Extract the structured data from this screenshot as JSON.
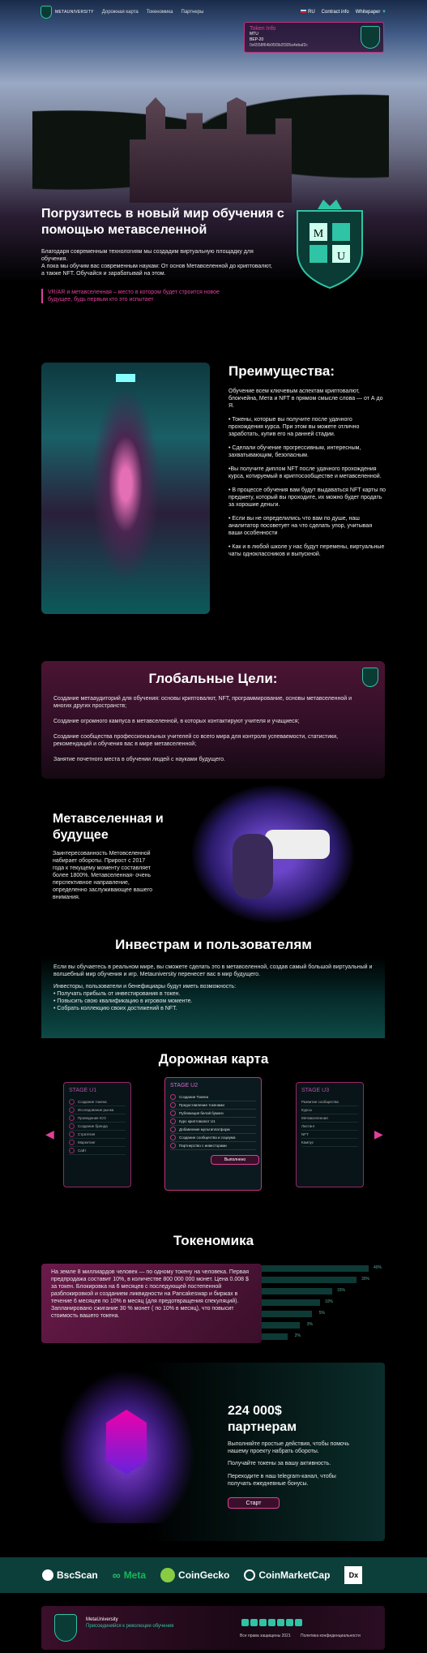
{
  "nav": {
    "logo": "METAUNIVERSITY",
    "links": [
      "Дорожная карта",
      "Токеномика",
      "Партнеры"
    ],
    "lang": "RU",
    "contract": "Contract info",
    "whitepaper": "Whitepaper"
  },
  "token_info": {
    "title": "Token Info",
    "name": "MTU",
    "line2": "BEP-20",
    "address": "0x6558f64b95f3b2f305a4ebaf2c"
  },
  "hero": {
    "title": "Погрузитесь в новый мир обучения с помощью метавселенной",
    "text1": "Благодаря современным технологиям мы создадим виртуальную площадку для обучения.",
    "text2": "А пока мы обучим вас современным наукам: От основ Метавселенной до криптовалют, а также NFT. Обучайся и зарабатывай на этом.",
    "quote": "VR/AR и метавселенная – место в котором будет строится новое будущее, будь первым кто это испытает"
  },
  "benefits": {
    "title": "Преимущества:",
    "items": [
      "Обучение всем ключевым аспектам криптовалют, блокчейна, Мета и NFT в прямом смысле слова — от А до Я.",
      "• Токены, которые вы получите после удачного прохождения курса. При этом вы можете отлично заработать, купив его на ранней стадии.",
      "• Сделали обучение прогрессивным, интересным, захватывающим, безопасным.",
      "•Вы получите диплом NFT после удачного прохождения курса, котируемый в криптосообществе и метавселенной.",
      "• В процессе обучения вам будут выдаваться NFT карты по предмету, который вы проходите, их можно будет продать за хорошие деньги.",
      "• Если вы не определились что вам по душе, наш аналитатор посоветует на что сделать упор, учитывая ваши особенности",
      "• Как и в любой школе у нас будут перемены, виртуальные чаты одноклассников и выпускной."
    ]
  },
  "goals": {
    "title": "Глобальные Цели:",
    "items": [
      "Создание метааудиторий для обучения: основы криптовалют, NFT, программирование, основы метавселенной и многих других пространств;",
      "Создание огромного кампуса в метавселенной, в которых контактируют учителя и учащиеся;",
      "Создание сообщества профессиональных учителей со всего мира для контроля успеваемости, статистики, рекомендаций и обучения вас в мире метавселенной;",
      "Занятие почетного места в обучении людей с науками будущего."
    ]
  },
  "meta": {
    "title": "Метавселенная и будущее",
    "text": "Заинтересованность Метовселенной набирает обороты. Прирост с 2017 года к текущему моменту составляет более 1800%. Метавселенная- очень перспективное направление, определенно заслуживающее вашего внимания."
  },
  "invest": {
    "title": "Инвестрам и пользователям",
    "text": "Если вы обучаетесь в реальном мире, вы сможете сделать это в метавселенной, создав самый большой виртуальный и волшебный мир обучения и игр. Metauniversity перенесет вас в мир будущего.",
    "sub": "Инвесторы, пользователи и бенефициары будут иметь возможность:",
    "items": [
      "• Получать прибыль от инвестирования в токен.",
      "• Повысить свою квалификацию в игровом моменте.",
      "• Собрать коллекцию своих достижений в NFT."
    ]
  },
  "roadmap": {
    "title": "Дорожная карта",
    "stages": [
      {
        "title": "STAGE U1",
        "rows": [
          "Создание токена",
          "Исследование рынка",
          "Проведение ICO",
          "Создание бренда",
          "Стратегия",
          "Маркетинг",
          "Сайт"
        ]
      },
      {
        "title": "STAGE U2",
        "rows": [
          "Создание Токена",
          "Предоставление токенами",
          "Публикация белой бумаги",
          "Курс криптовалют U1",
          "Добавление мультиплатформ",
          "Создание сообщества и социума",
          "Партнерство с инвесторами"
        ],
        "button": "Выполнено"
      },
      {
        "title": "STAGE U3",
        "rows": [
          "Развитие сообщества",
          "Курсы",
          "Метавселенная",
          "Листинг",
          "NFT",
          "Кампус"
        ]
      }
    ]
  },
  "tokenomics": {
    "title": "Токеномика",
    "text": "На земле 8 миллиардов человек — по одному токену на человека. Первая предпродажа составит 10%, в количестве 800 000 000 монет. Цена 0.008 $ за токен. Блокировка на 6 месяцев с последующей постепенной разблокировкой и созданием ликвидности на Pancakeswap и биржах в течение 6 месяцев по 10% в месяц (для предотвращения спекуляций). Запланировано сжигание 30 % монет ( по 10% в месяц), что повысит стоимость вашего токена.",
    "percents": [
      "40%",
      "30%",
      "15%",
      "10%",
      "5%",
      "3%",
      "2%"
    ]
  },
  "partners": {
    "title": "224 000$ партнерам",
    "t1": "Выполняйте простые действия, чтобы помочь нашему проекту набрать обороты.",
    "t2": "Получайте токены за вашу активность.",
    "t3": "Переходите в наш telegram-канал, чтобы получать ежедневные бонусы.",
    "button": "Старт"
  },
  "logos": [
    "BscScan",
    "Meta",
    "CoinGecko",
    "CoinMarketCap",
    "Dx"
  ],
  "footer": {
    "brand": "MetaUniversity",
    "tagline": "Присоединяйся к революции обучения",
    "copy": "Все права защищены 2021",
    "policy": "Политика конфиденциальности"
  }
}
